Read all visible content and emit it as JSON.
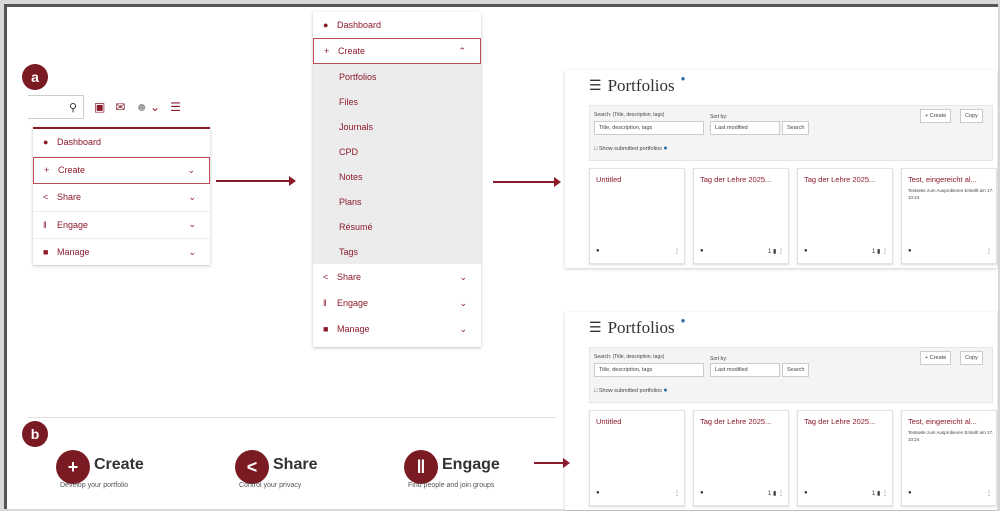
{
  "labels": {
    "a": "a",
    "b": "b"
  },
  "topbar": {
    "search_icon": "search-icon",
    "icons": [
      "id-card-icon",
      "mail-icon",
      "user-icon",
      "chevron-down-icon",
      "hamburger-icon"
    ]
  },
  "menu_collapsed": [
    {
      "icon": "●",
      "label": "Dashboard",
      "chev": false,
      "active": false
    },
    {
      "icon": "+",
      "label": "Create",
      "chev": true,
      "active": true
    },
    {
      "icon": "<",
      "label": "Share",
      "chev": true,
      "active": false
    },
    {
      "icon": "ǁ",
      "label": "Engage",
      "chev": true,
      "active": false
    },
    {
      "icon": "■",
      "label": "Manage",
      "chev": true,
      "active": false
    }
  ],
  "menu_expanded": {
    "dashboard": "Dashboard",
    "create": "Create",
    "sub": [
      "Portfolios",
      "Files",
      "Journals",
      "CPD",
      "Notes",
      "Plans",
      "Résumé",
      "Tags"
    ],
    "share": "Share",
    "engage": "Engage",
    "manage": "Manage"
  },
  "portfolio_screen": {
    "title": "Portfolios",
    "search_label": "Search: (Title, description, tags)",
    "search_select": "Title, description, tags",
    "sort_label": "Sort by:",
    "sort_select": "Last modified",
    "search_button": "Search",
    "create_button": "+ Create",
    "copy_button": "Copy",
    "show_submitted": "Show submitted portfolios",
    "cards": [
      {
        "title": "Untitled",
        "desc": "",
        "count": ""
      },
      {
        "title": "Tag der Lehre 2025...",
        "desc": "",
        "count": "1"
      },
      {
        "title": "Tag der Lehre 2025...",
        "desc": "",
        "count": "1"
      },
      {
        "title": "Test, eingereicht al...",
        "desc": "Testseite zum Ausprobieren Erstellt am 17. 10:24",
        "count": ""
      }
    ]
  },
  "section_b": [
    {
      "title": "Create",
      "sub": "Develop your portfolio",
      "icon": "+"
    },
    {
      "title": "Share",
      "sub": "Control your privacy",
      "icon": "<"
    },
    {
      "title": "Engage",
      "sub": "Find people and join groups",
      "icon": "ǁ"
    }
  ],
  "colors": {
    "accent": "#8b1a2b",
    "badge": "#7a1a22",
    "info": "#2a6aa8"
  }
}
